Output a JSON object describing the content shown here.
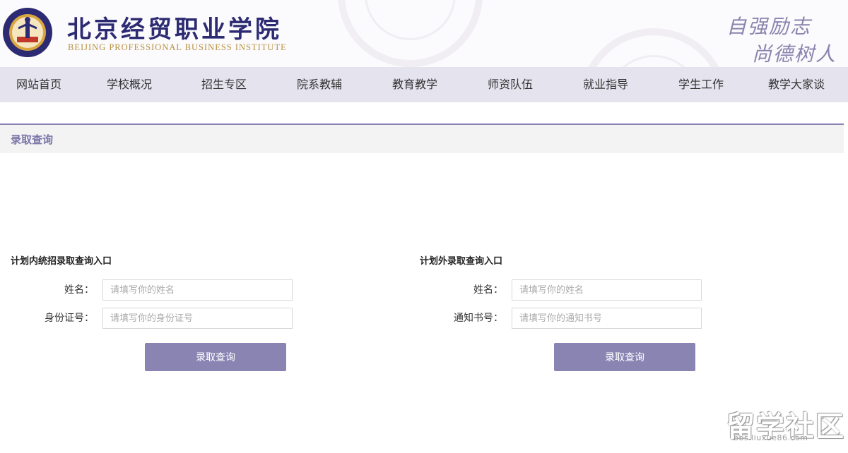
{
  "header": {
    "school_name_cn": "北京经贸职业学院",
    "school_name_en": "BEIJING PROFESSIONAL BUSINESS INSTITUTE",
    "motto_line1": "自强励志",
    "motto_line2": "尚德树人",
    "colors": {
      "brand": "#2c2a72",
      "gold": "#b8913e",
      "accent": "#8a84b3"
    }
  },
  "nav": {
    "items": [
      "网站首页",
      "学校概况",
      "招生专区",
      "院系教辅",
      "教育教学",
      "师资队伍",
      "就业指导",
      "学生工作",
      "教学大家谈"
    ]
  },
  "section": {
    "title": "录取查询"
  },
  "form_in_plan": {
    "title": "计划内统招录取查询入口",
    "name_label": "姓名：",
    "name_placeholder": "请填写你的姓名",
    "id_label": "身份证号：",
    "id_placeholder": "请填写你的身份证号",
    "button": "录取查询"
  },
  "form_out_plan": {
    "title": "计划外录取查询入口",
    "name_label": "姓名：",
    "name_placeholder": "请填写你的姓名",
    "notice_label": "通知书号：",
    "notice_placeholder": "请填写你的通知书号",
    "button": "录取查询"
  },
  "watermark": {
    "text": "留学社区",
    "url": "bbs.liuxue86.com"
  }
}
